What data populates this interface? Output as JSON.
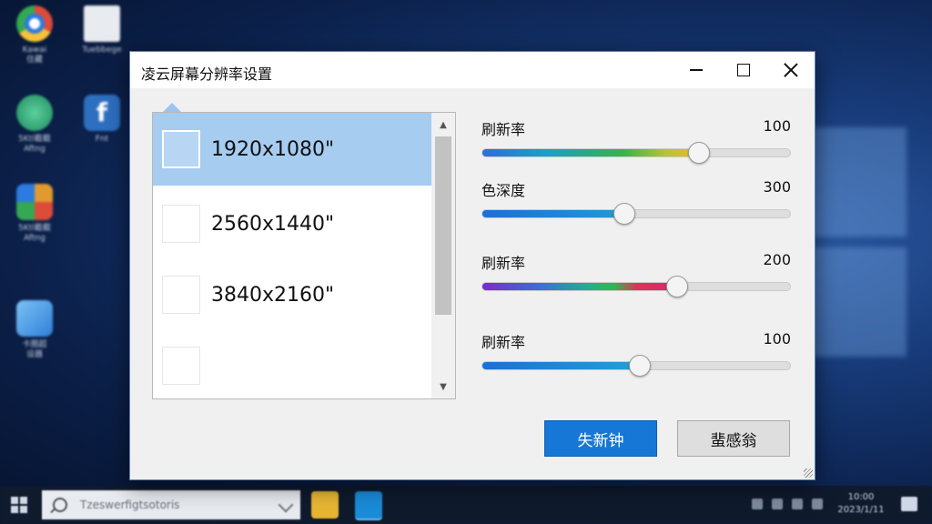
{
  "desktop": {
    "icons": [
      {
        "label": "Kawai\n住藏",
        "color": "#dd4b39"
      },
      {
        "label": "Tuebbege",
        "color": "#e5e5e5"
      },
      {
        "label": "5Ktl截截\nAftng",
        "color": "#2f9a6a"
      },
      {
        "label": "Fnt",
        "color": "#2d6fc0"
      },
      {
        "label": "5Ktl截截\nAftng",
        "color": "#e09a30"
      },
      {
        "label": "卡圈超\n设器",
        "color": "#3b8fe0"
      }
    ]
  },
  "taskbar": {
    "search_placeholder": "Tzeswerfigtsotoris",
    "clock_time": "10:00",
    "clock_date": "2023/1/11"
  },
  "dialog": {
    "title": "凌云屏幕分辨率设置",
    "resolutions": [
      {
        "label": "1920x1080\"",
        "selected": true
      },
      {
        "label": "2560x1440\"",
        "selected": false
      },
      {
        "label": "3840x2160\"",
        "selected": false
      },
      {
        "label": "",
        "selected": false
      }
    ],
    "sliders": [
      {
        "label": "刷新率",
        "value": "100",
        "fraction": 0.7,
        "fill": "linear-gradient(90deg,#2d6fd6,#1aa0c8 30%,#38b24a 65%,#b7c436 85%,#e8b92c)"
      },
      {
        "label": "色深度",
        "value": "300",
        "fraction": 0.46,
        "fill": "linear-gradient(90deg,#1e6ed6,#1f9ad6)"
      },
      {
        "label": "刷新率",
        "value": "200",
        "fraction": 0.63,
        "fill": "linear-gradient(90deg,#7a2ad0,#3c6fd6 30%,#21b08a 55%,#2fb84a 68%,#e0305a 80%,#d62a6a)"
      },
      {
        "label": "刷新率",
        "value": "100",
        "fraction": 0.51,
        "fill": "linear-gradient(90deg,#1e6ed6,#1fa2d6)"
      }
    ],
    "ok_label": "失新钟",
    "cancel_label": "蜚感翁"
  }
}
